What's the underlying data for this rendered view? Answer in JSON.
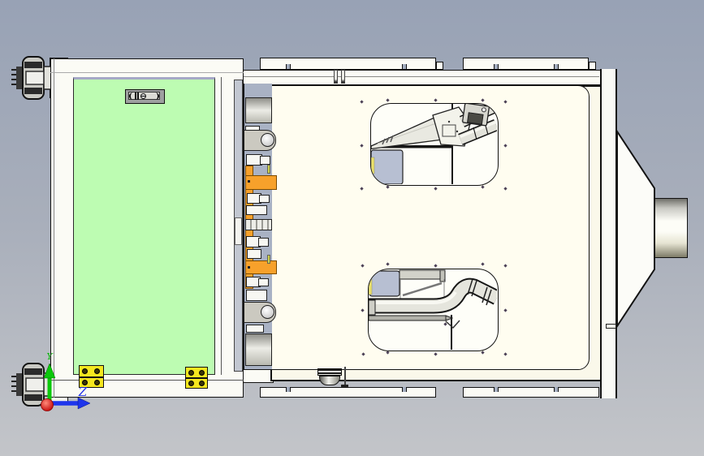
{
  "viewport": {
    "description": "CAD top view of enclosure machine assembly"
  },
  "axis_triad": {
    "y_label": "Y",
    "z_label": "Z"
  },
  "colors": {
    "background_top": "#98A2B5",
    "background_bottom": "#C3C5C9",
    "door_glass_green": "#BDFCB2",
    "enclosure_face_cream": "#FFFDF0",
    "enclosure_plate_cream": "#FAF8EA",
    "frame_white": "#FBFBF5",
    "carriage_strip_blue": "#A9B2C4",
    "clamp_orange": "#F7A12B",
    "hinge_yellow": "#F5E71F",
    "corner_plate_blue": "#B7BFD2",
    "axis_y_green": "#0AB40A",
    "axis_z_blue": "#1F35EC",
    "axis_origin_red": "#D81F1F"
  }
}
